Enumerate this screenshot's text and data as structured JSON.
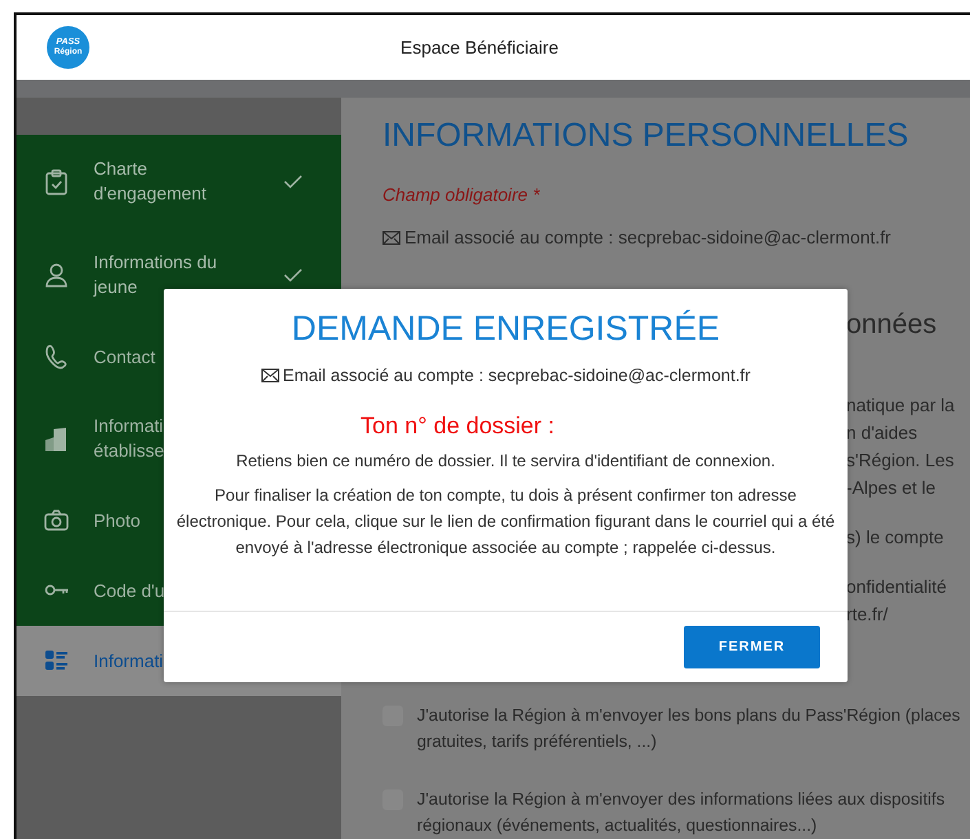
{
  "header": {
    "logo_lines": [
      "PASS",
      "Région"
    ],
    "title": "Espace Bénéficiaire"
  },
  "sidebar": {
    "items": [
      {
        "kind": "clipboard",
        "label_lines": [
          "Charte",
          "d'engagement"
        ],
        "done": true,
        "selected": false
      },
      {
        "kind": "person",
        "label_lines": [
          "Informations du",
          "jeune"
        ],
        "done": true,
        "selected": false
      },
      {
        "kind": "phone",
        "label_lines": [
          "Contact"
        ],
        "done": false,
        "selected": false
      },
      {
        "kind": "building",
        "label_lines": [
          "Informati",
          "établisse"
        ],
        "done": false,
        "selected": false
      },
      {
        "kind": "camera",
        "label_lines": [
          "Photo"
        ],
        "done": false,
        "selected": false
      },
      {
        "kind": "key",
        "label_lines": [
          "Code d'u"
        ],
        "done": false,
        "selected": false
      },
      {
        "kind": "checklist",
        "label_lines": [
          "Informati"
        ],
        "done": false,
        "selected": true
      }
    ]
  },
  "content": {
    "title": "INFORMATIONS PERSONNELLES",
    "required_note": "Champ obligatoire *",
    "email_line": "Email associé au compte : secprebac-sidoine@ac-clermont.fr",
    "section_heading": "onnées",
    "fragments": [
      [
        "natique par la",
        "n d'aides",
        "s'Région. Les",
        "-Alpes et le"
      ],
      [
        "s) le compte"
      ],
      [
        "onfidentialité",
        "rte.fr/"
      ]
    ],
    "consents": [
      {
        "label": "J'autorise la Région à m'envoyer les bons plans du Pass'Région (places gratuites, tarifs préférentiels, ...)",
        "checked": false
      },
      {
        "label": "J'autorise la Région à m'envoyer des informations liées aux dispositifs régionaux (événements, actualités, questionnaires...)",
        "checked": false
      }
    ]
  },
  "modal": {
    "title": "DEMANDE ENREGISTRÉE",
    "email_line": "Email associé au compte : secprebac-sidoine@ac-clermont.fr",
    "dossier_label": "Ton n° de dossier :",
    "paragraphs": [
      "Retiens bien ce numéro de dossier. Il te servira d'identifiant de connexion.",
      "Pour finaliser la création de ton compte, tu dois à présent confirmer ton adresse électronique. Pour cela, clique sur le lien de confirmation figurant dans le courriel qui a été envoyé à l'adresse électronique associée au compte ; rappelée ci-dessus."
    ],
    "button": "FERMER"
  }
}
